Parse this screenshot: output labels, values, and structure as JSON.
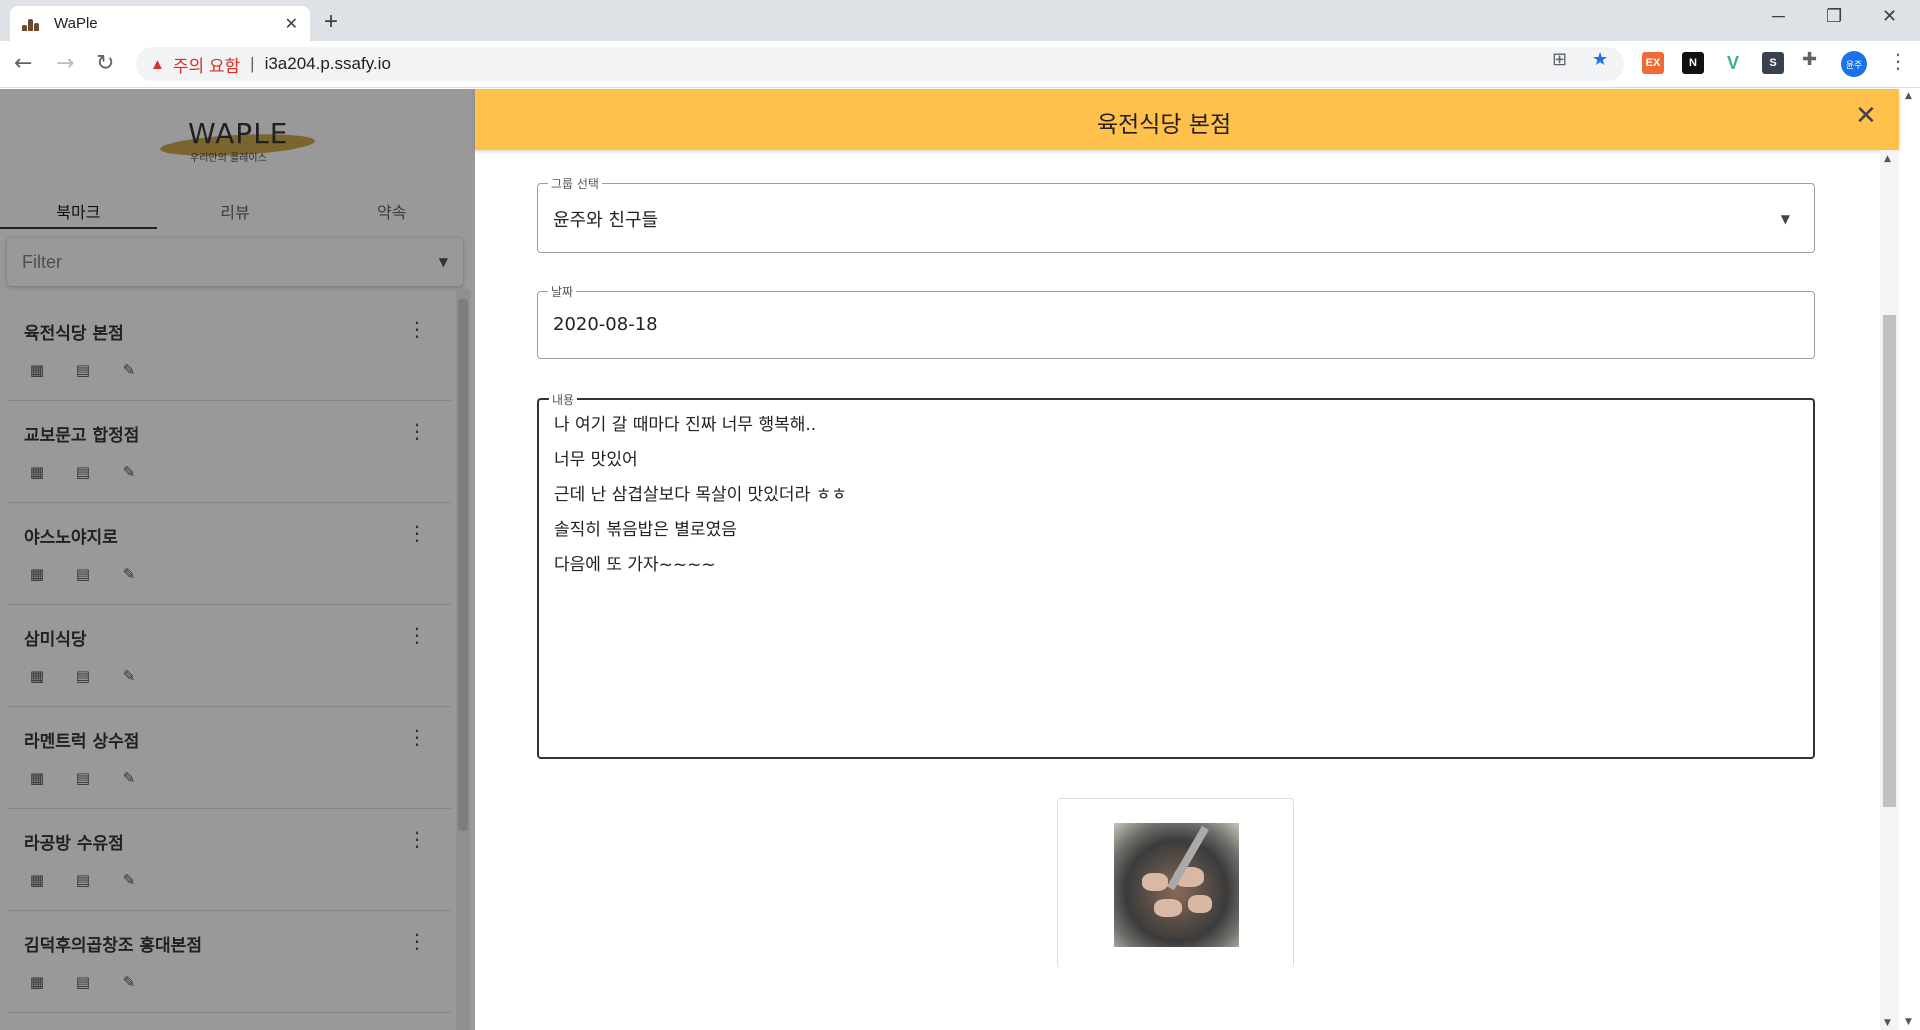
{
  "browser": {
    "tab_title": "WaPle",
    "address": {
      "warning": "주의 요함",
      "separator": "|",
      "url": "i3a204.p.ssafy.io"
    },
    "extensions": [
      "EX",
      "N",
      "V",
      "S"
    ],
    "profile_label": "윤주"
  },
  "sidebar": {
    "logo_word": "WAPLE",
    "logo_sub": "우리만의 플레이스",
    "tabs": [
      {
        "label": "북마크",
        "active": true
      },
      {
        "label": "리뷰",
        "active": false
      },
      {
        "label": "약속",
        "active": false
      }
    ],
    "filter_placeholder": "Filter",
    "items": [
      {
        "name": "육전식당 본점"
      },
      {
        "name": "교보문고 합정점"
      },
      {
        "name": "야스노야지로"
      },
      {
        "name": "삼미식당"
      },
      {
        "name": "라멘트럭 상수점"
      },
      {
        "name": "라공방 수유점"
      },
      {
        "name": "김덕후의곱창조 홍대본점"
      }
    ]
  },
  "dialog": {
    "title": "육전식당 본점",
    "group": {
      "label": "그룹 선택",
      "value": "윤주와 친구들"
    },
    "date": {
      "label": "날짜",
      "value": "2020-08-18"
    },
    "content": {
      "label": "내용",
      "lines": [
        "나 여기 갈 때마다 진짜 너무 행복해..",
        "너무 맛있어",
        "근데 난 삼겹살보다 목살이 맛있더라 ㅎㅎ",
        "솔직히 볶음밥은 별로였음",
        "다음에 또 가자~~~~"
      ]
    }
  },
  "colors": {
    "header_accent": "#ffc04c",
    "warning": "#d93025",
    "logo_swash": "#c8a03c"
  }
}
